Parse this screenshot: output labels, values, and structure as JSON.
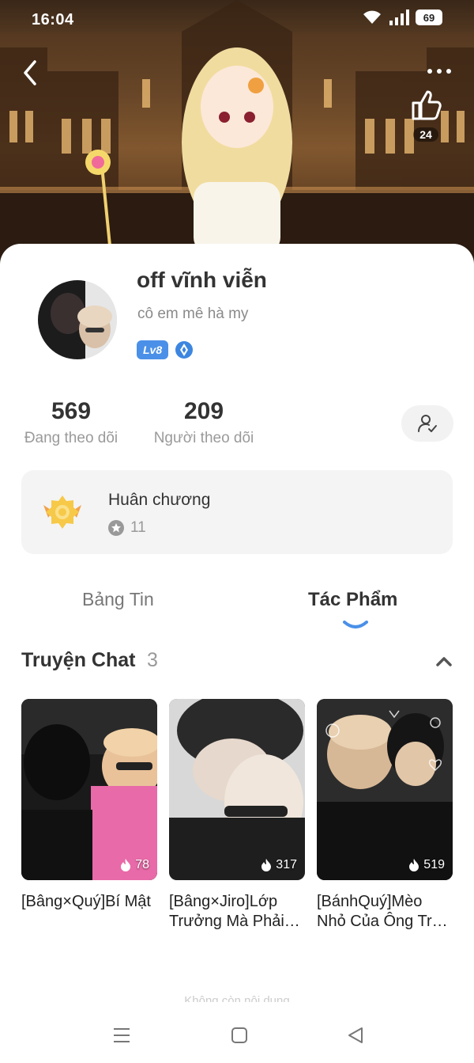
{
  "status_bar": {
    "time": "16:04",
    "battery": "69"
  },
  "hero": {
    "like_count": "24"
  },
  "profile": {
    "name": "off vĩnh viễn",
    "bio": "cô em mê hà my",
    "level": "Lv8"
  },
  "stats": {
    "following_count": "569",
    "following_label": "Đang theo dõi",
    "followers_count": "209",
    "followers_label": "Người theo dõi"
  },
  "medals": {
    "title": "Huân chương",
    "count": "11"
  },
  "tabs": [
    {
      "label": "Bảng Tin",
      "active": false
    },
    {
      "label": "Tác Phẩm",
      "active": true
    }
  ],
  "section": {
    "title": "Truyện Chat",
    "count": "3"
  },
  "stories": [
    {
      "title": "[Bâng×Quý]Bí Mật",
      "views": "78"
    },
    {
      "title": "[Bâng×Jiro]Lớp Trưởng Mà Phải…",
      "views": "317"
    },
    {
      "title": "[BánhQuý]Mèo Nhỏ Của Ông Tr…",
      "views": "519"
    }
  ],
  "footer": {
    "hint": "Không còn nội dung"
  },
  "colors": {
    "accent": "#4a90e8",
    "level_badge": "#4a90e8",
    "card_bg": "#f4f4f4"
  },
  "icons": {
    "back": "chevron-left-icon",
    "more": "more-dots-icon",
    "like": "thumbs-up-icon",
    "gem": "diamond-icon",
    "follow_action": "user-check-icon",
    "medal": "medal-icon",
    "star": "star-icon",
    "collapse": "chevron-up-icon",
    "views": "flame-icon"
  }
}
